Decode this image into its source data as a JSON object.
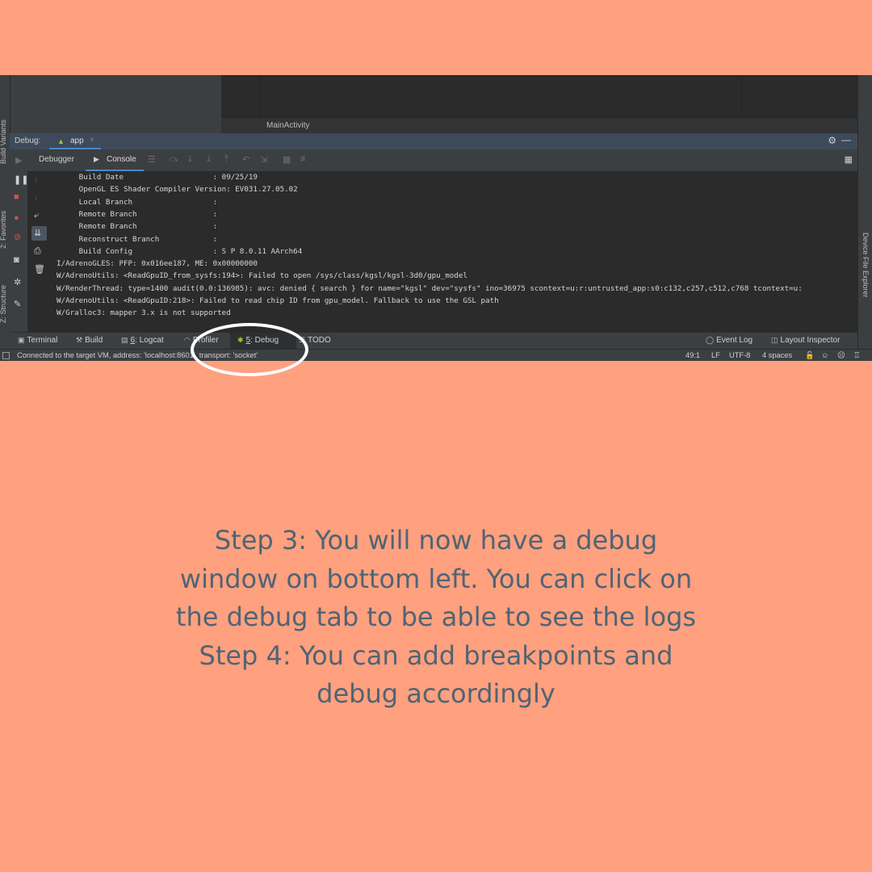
{
  "ide": {
    "editor_breadcrumb": "MainActivity",
    "left_strip_tabs": [
      "Build Variants",
      "2: Favorites",
      "Z: Structure"
    ],
    "right_strip_tab": "Device File Explorer",
    "debug_label": "Debug:",
    "debug_session_tab": "app",
    "close_glyph": "×",
    "settings_icon": "gear-icon",
    "subtabs": {
      "debugger": "Debugger",
      "console": "Console"
    },
    "console_lines": [
      "     Build Date                    : 09/25/19",
      "     OpenGL ES Shader Compiler Version: EV031.27.05.02",
      "     Local Branch                  :",
      "     Remote Branch                 :",
      "     Remote Branch                 :",
      "     Reconstruct Branch            :",
      "     Build Config                  : S P 8.0.11 AArch64",
      "I/AdrenoGLES: PFP: 0x016ee187, ME: 0x00000000",
      "W/AdrenoUtils: <ReadGpuID_from_sysfs:194>: Failed to open /sys/class/kgsl/kgsl-3d0/gpu_model",
      "W/RenderThread: type=1400 audit(0.0:136985): avc: denied { search } for name=\"kgsl\" dev=\"sysfs\" ino=36975 scontext=u:r:untrusted_app:s0:c132,c257,c512,c768 tcontext=u:",
      "W/AdrenoUtils: <ReadGpuID:218>: Failed to read chip ID from gpu_model. Fallback to use the GSL path",
      "W/Gralloc3: mapper 3.x is not supported"
    ],
    "tool_windows": {
      "terminal": "Terminal",
      "build": "Build",
      "logcat_num": "6",
      "logcat_label": ": Logcat",
      "profiler": "Profiler",
      "debug_num": "5",
      "debug_label": ": Debug",
      "todo": "TODO",
      "event_log": "Event Log",
      "layout_inspector": "Layout Inspector"
    },
    "status": {
      "message": "Connected to the target VM, address: 'localhost:8601', transport: 'socket'",
      "position": "49:1",
      "line_sep": "LF",
      "encoding": "UTF-8",
      "indent": "4 spaces"
    }
  },
  "caption": {
    "line1": "Step 3: You will now have a debug",
    "line2": "window on bottom left. You can click on",
    "line3": "the debug tab to be able to see the logs",
    "line4": "Step 4: You can add breakpoints and",
    "line5": "debug accordingly"
  },
  "colors": {
    "background": "#FFA07E",
    "caption_text": "#4F6475",
    "ide_bg": "#2b2b2b",
    "highlight": "#FFFFFF",
    "stop_red": "#C75450",
    "debug_title_bar": "#3d4a5a"
  }
}
